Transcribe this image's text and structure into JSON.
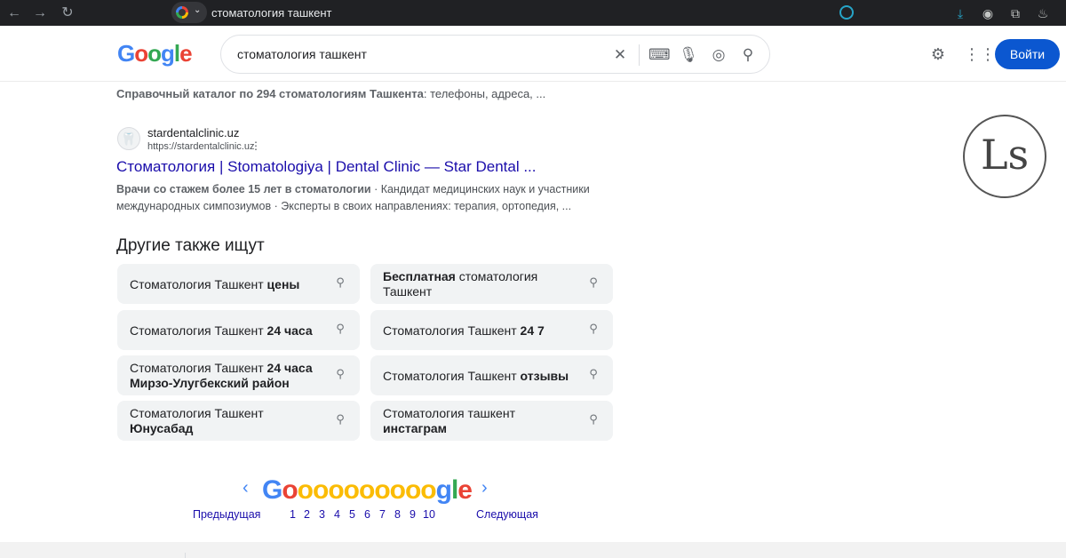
{
  "browser": {
    "address_text": "стоматология ташкент",
    "back_icon": "←",
    "forward_icon": "→",
    "reload_icon": "↻",
    "dropdown_icon": "⌄"
  },
  "header": {
    "logo_letters": [
      {
        "ch": "G",
        "color": "#4285f4"
      },
      {
        "ch": "o",
        "color": "#ea4335"
      },
      {
        "ch": "o",
        "color": "#34a853"
      },
      {
        "ch": "g",
        "color": "#4285f4"
      },
      {
        "ch": "l",
        "color": "#34a853"
      },
      {
        "ch": "e",
        "color": "#ea4335"
      }
    ],
    "search_query": "стоматология ташкент",
    "login_label": "Войти"
  },
  "snippet_top": {
    "bold": "Справочный каталог по 294 стоматологиям Ташкента",
    "rest": ": телефоны, адреса, ..."
  },
  "result": {
    "favicon": "🦷",
    "site_name": "stardentalclinic.uz",
    "site_url": "https://stardentalclinic.uz",
    "more": "⋮",
    "title": "Стоматология | Stomatologiya | Dental Clinic — Star Dental ...",
    "desc_bold": "Врачи со стажем более 15 лет в стоматологии",
    "desc_rest_1": " · Кандидат медицинских наук и участники",
    "desc_line2": "международных симпозиумов · Эксперты в своих направлениях: терапия, ортопедия, ..."
  },
  "others": {
    "title": "Другие также ищут",
    "chips": [
      {
        "plain": "Стоматология Ташкент ",
        "bold": "цены",
        "bold_first": false
      },
      {
        "plain": " стоматология Ташкент",
        "bold": "Бесплатная",
        "bold_first": true
      },
      {
        "plain": "Стоматология Ташкент ",
        "bold": "24 часа",
        "bold_first": false
      },
      {
        "plain": "Стоматология Ташкент ",
        "bold": "24 7",
        "bold_first": false
      },
      {
        "plain": "Стоматология Ташкент ",
        "bold": "24 часа Мирзо-Улугбекский район",
        "bold_first": false
      },
      {
        "plain": "Стоматология Ташкент ",
        "bold": "отзывы",
        "bold_first": false
      },
      {
        "plain": "Стоматология Ташкент ",
        "bold": "Юнусабад",
        "bold_first": false
      },
      {
        "plain": "Стоматология ташкент ",
        "bold": "инстаграм",
        "bold_first": false
      }
    ]
  },
  "ls_logo": "Ls",
  "pagination": {
    "prev_arrow": "‹",
    "next_arrow": "›",
    "prev_label": "Предыдущая",
    "next_label": "Следующая",
    "pages": [
      "1",
      "2",
      "3",
      "4",
      "5",
      "6",
      "7",
      "8",
      "9",
      "10"
    ],
    "gooo_letters": [
      {
        "ch": "G",
        "color": "#4285f4"
      },
      {
        "ch": "o",
        "color": "#ea4335"
      },
      {
        "ch": "o",
        "color": "#fbbc05"
      },
      {
        "ch": "o",
        "color": "#fbbc05"
      },
      {
        "ch": "o",
        "color": "#fbbc05"
      },
      {
        "ch": "o",
        "color": "#fbbc05"
      },
      {
        "ch": "o",
        "color": "#fbbc05"
      },
      {
        "ch": "o",
        "color": "#fbbc05"
      },
      {
        "ch": "o",
        "color": "#fbbc05"
      },
      {
        "ch": "o",
        "color": "#fbbc05"
      },
      {
        "ch": "o",
        "color": "#fbbc05"
      },
      {
        "ch": "g",
        "color": "#4285f4"
      },
      {
        "ch": "l",
        "color": "#34a853"
      },
      {
        "ch": "e",
        "color": "#ea4335"
      }
    ]
  }
}
